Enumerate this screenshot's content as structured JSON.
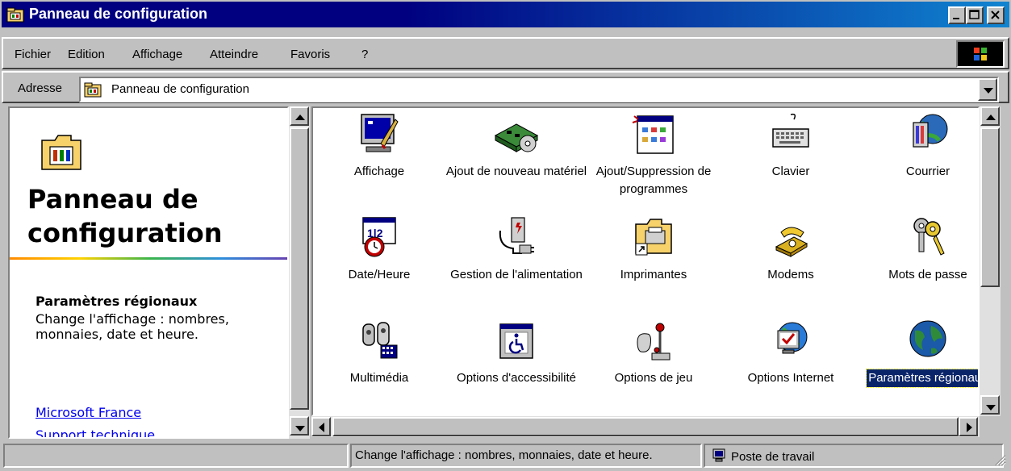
{
  "window": {
    "title": "Panneau de configuration"
  },
  "menu": [
    "Fichier",
    "Edition",
    "Affichage",
    "Atteindre",
    "Favoris",
    "?"
  ],
  "address": {
    "label": "Adresse",
    "value": "Panneau de configuration"
  },
  "left_pane": {
    "title": "Panneau de configuration",
    "selected_title": "Paramètres régionaux",
    "selected_description": "Change l'affichage : nombres, monnaies, date et heure.",
    "links": [
      "Microsoft France",
      "Support technique"
    ]
  },
  "items": [
    {
      "label": "Affichage",
      "icon": "display-icon"
    },
    {
      "label": "Ajout de nouveau matériel",
      "icon": "add-hardware-icon"
    },
    {
      "label": "Ajout/Suppression de programmes",
      "icon": "add-remove-programs-icon"
    },
    {
      "label": "Clavier",
      "icon": "keyboard-icon"
    },
    {
      "label": "Courrier",
      "icon": "mail-icon"
    },
    {
      "label": "Date/Heure",
      "icon": "date-time-icon"
    },
    {
      "label": "Gestion de l'alimentation",
      "icon": "power-management-icon"
    },
    {
      "label": "Imprimantes",
      "icon": "printers-folder-icon"
    },
    {
      "label": "Modems",
      "icon": "modem-phone-icon"
    },
    {
      "label": "Mots de passe",
      "icon": "passwords-keys-icon"
    },
    {
      "label": "Multimédia",
      "icon": "multimedia-icon"
    },
    {
      "label": "Options d'accessibilité",
      "icon": "accessibility-icon"
    },
    {
      "label": "Options de jeu",
      "icon": "joystick-icon"
    },
    {
      "label": "Options Internet",
      "icon": "internet-options-icon"
    },
    {
      "label": "Paramètres régionaux",
      "icon": "globe-icon",
      "selected": true
    }
  ],
  "status": {
    "text": "Change l'affichage : nombres, monnaies, date et heure.",
    "zone": "Poste de travail"
  },
  "colors": {
    "titlebar_start": "#000080",
    "titlebar_end": "#1084d0",
    "selection": "#0a246a",
    "link": "#0000ee"
  }
}
